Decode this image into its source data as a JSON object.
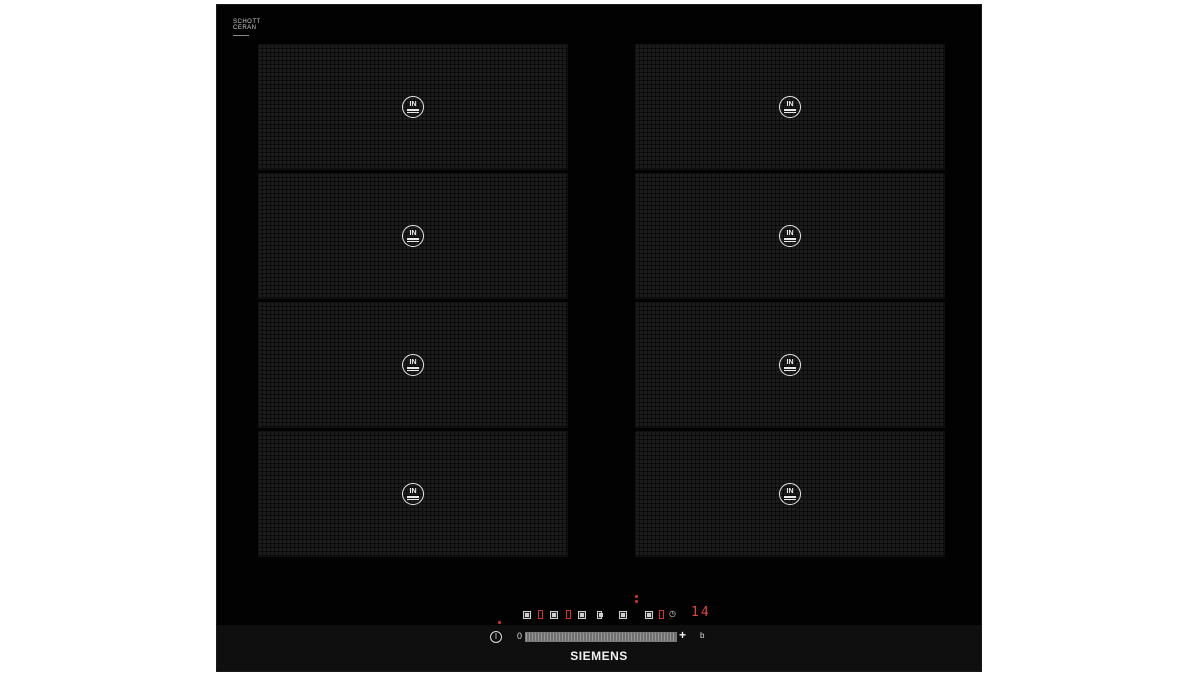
{
  "glass_brand": {
    "line1": "SCHOTT",
    "line2": "CERAN"
  },
  "zones": [
    {
      "id": "left-1",
      "badge": "IN"
    },
    {
      "id": "left-2",
      "badge": "IN"
    },
    {
      "id": "left-3",
      "badge": "IN"
    },
    {
      "id": "left-4",
      "badge": "IN"
    },
    {
      "id": "right-1",
      "badge": "IN"
    },
    {
      "id": "right-2",
      "badge": "IN"
    },
    {
      "id": "right-3",
      "badge": "IN"
    },
    {
      "id": "right-4",
      "badge": "IN"
    }
  ],
  "controls": {
    "timer_readout": "14",
    "power_symbol": "I",
    "slider_min": "0",
    "slider_max": "+",
    "booster": "b"
  },
  "manufacturer": "SIEMENS",
  "colors": {
    "glass": "#020202",
    "zone": "#1c1c1c",
    "indicator_red": "#d9342b"
  }
}
